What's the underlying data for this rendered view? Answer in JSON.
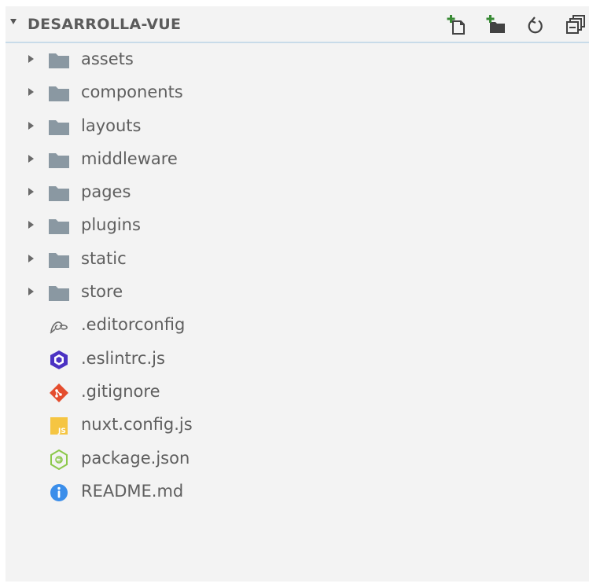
{
  "explorer": {
    "title": "DESARROLLA-VUE",
    "actions": [
      {
        "name": "new-file-button",
        "icon": "new-file-icon"
      },
      {
        "name": "new-folder-button",
        "icon": "new-folder-icon"
      },
      {
        "name": "refresh-button",
        "icon": "refresh-icon"
      },
      {
        "name": "collapse-all-button",
        "icon": "collapse-all-icon"
      }
    ],
    "folders": [
      {
        "label": "assets",
        "icon": "folder-icon"
      },
      {
        "label": "components",
        "icon": "folder-icon"
      },
      {
        "label": "layouts",
        "icon": "folder-icon"
      },
      {
        "label": "middleware",
        "icon": "folder-icon"
      },
      {
        "label": "pages",
        "icon": "folder-icon"
      },
      {
        "label": "plugins",
        "icon": "folder-icon"
      },
      {
        "label": "static",
        "icon": "folder-icon"
      },
      {
        "label": "store",
        "icon": "folder-icon"
      }
    ],
    "files": [
      {
        "label": ".editorconfig",
        "icon": "editorconfig-icon"
      },
      {
        "label": ".eslintrc.js",
        "icon": "eslint-icon"
      },
      {
        "label": ".gitignore",
        "icon": "git-icon"
      },
      {
        "label": "nuxt.config.js",
        "icon": "javascript-icon"
      },
      {
        "label": "package.json",
        "icon": "nodejs-icon"
      },
      {
        "label": "README.md",
        "icon": "info-icon"
      }
    ],
    "colors": {
      "panel_bg": "#f3f3f3",
      "folder": "#8a98a2",
      "accent_border": "#c8dbe9",
      "new_icon_green": "#388a34",
      "eslint": "#4b32c3",
      "git": "#e44d2e",
      "javascript": "#f5c542",
      "nodejs": "#8cc84b",
      "info": "#3b8eea"
    }
  }
}
